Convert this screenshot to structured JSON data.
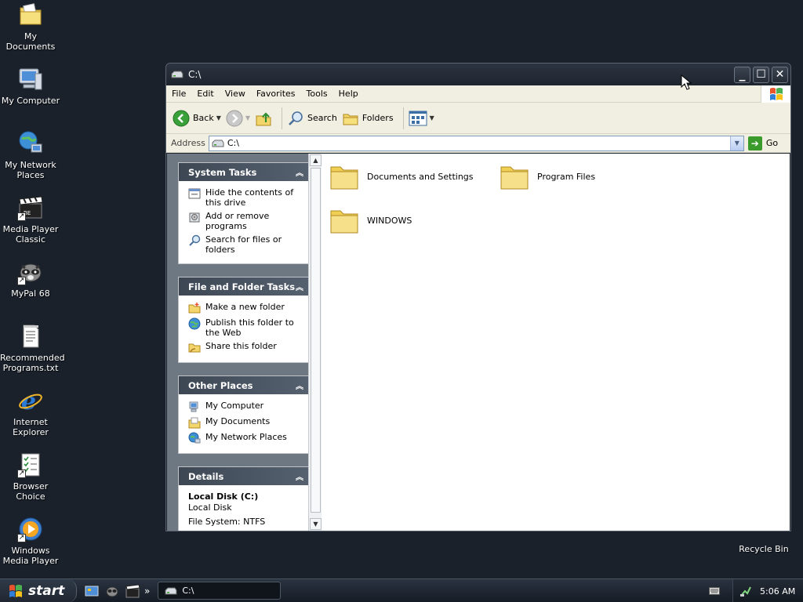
{
  "desktop": {
    "icons": [
      {
        "label": "My Documents"
      },
      {
        "label": "My Computer"
      },
      {
        "label": "My Network Places"
      },
      {
        "label": "Media Player Classic"
      },
      {
        "label": "MyPal 68"
      },
      {
        "label": "Recommended Programs.txt"
      },
      {
        "label": "Internet Explorer"
      },
      {
        "label": "Browser Choice"
      },
      {
        "label": "Windows Media Player"
      },
      {
        "label": "Recycle Bin"
      }
    ]
  },
  "window": {
    "title": "C:\\",
    "menu": [
      "File",
      "Edit",
      "View",
      "Favorites",
      "Tools",
      "Help"
    ],
    "toolbar": {
      "back": "Back",
      "search": "Search",
      "folders": "Folders"
    },
    "address": {
      "label": "Address",
      "value": "C:\\",
      "go": "Go"
    },
    "taskpane": {
      "system_tasks": {
        "title": "System Tasks",
        "items": [
          "Hide the contents of this drive",
          "Add or remove programs",
          "Search for files or folders"
        ]
      },
      "file_folder_tasks": {
        "title": "File and Folder Tasks",
        "items": [
          "Make a new folder",
          "Publish this folder to the Web",
          "Share this folder"
        ]
      },
      "other_places": {
        "title": "Other Places",
        "items": [
          "My Computer",
          "My Documents",
          "My Network Places"
        ]
      },
      "details": {
        "title": "Details",
        "name": "Local Disk (C:)",
        "type": "Local Disk",
        "filesystem": "File System: NTFS"
      }
    },
    "files": [
      {
        "name": "Documents and Settings"
      },
      {
        "name": "Program Files"
      },
      {
        "name": "WINDOWS"
      }
    ]
  },
  "taskbar": {
    "start": "start",
    "task_button": "C:\\",
    "clock": "5:06 AM"
  }
}
